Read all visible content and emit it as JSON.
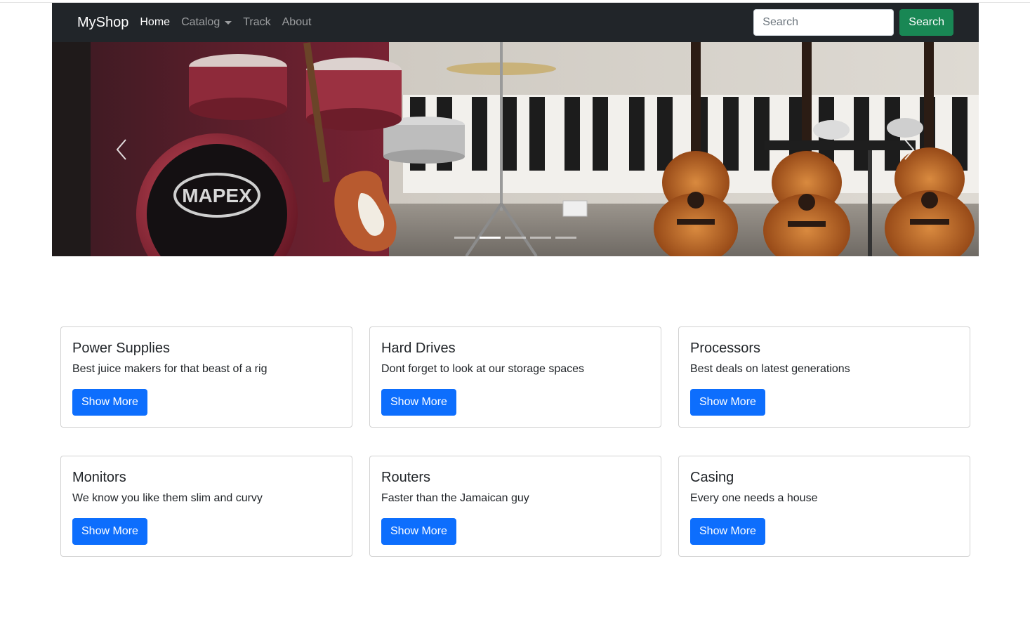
{
  "navbar": {
    "brand": "MyShop",
    "links": [
      {
        "label": "Home"
      },
      {
        "label": "Catalog"
      },
      {
        "label": "Track"
      },
      {
        "label": "About"
      }
    ],
    "search": {
      "placeholder": "Search",
      "value": "",
      "button_label": "Search"
    },
    "colors": {
      "background": "#212529",
      "search_button": "#198754"
    }
  },
  "carousel": {
    "slide_count": 5,
    "active_index": 1,
    "prev_icon": "chevron-left-icon",
    "next_icon": "chevron-right-icon"
  },
  "cards": [
    {
      "title": "Power Supplies",
      "text": "Best juice makers for that beast of a rig",
      "button_label": "Show More"
    },
    {
      "title": "Hard Drives",
      "text": "Dont forget to look at our storage spaces",
      "button_label": "Show More"
    },
    {
      "title": "Processors",
      "text": "Best deals on latest generations",
      "button_label": "Show More"
    },
    {
      "title": "Monitors",
      "text": "We know you like them slim and curvy",
      "button_label": "Show More"
    },
    {
      "title": "Routers",
      "text": "Faster than the Jamaican guy",
      "button_label": "Show More"
    },
    {
      "title": "Casing",
      "text": "Every one needs a house",
      "button_label": "Show More"
    }
  ],
  "colors": {
    "primary_button": "#0d6efd"
  }
}
